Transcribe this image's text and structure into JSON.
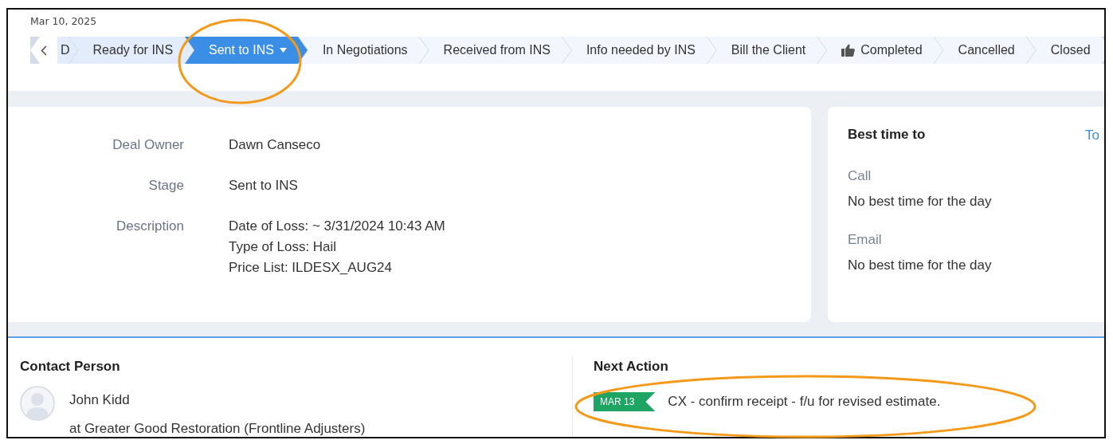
{
  "header": {
    "date": "Mar 10, 2025"
  },
  "stages": [
    {
      "label": "D",
      "kind": "stage",
      "done": true,
      "selected": false
    },
    {
      "label": "Ready for INS",
      "kind": "stage",
      "done": true,
      "selected": false
    },
    {
      "label": "Sent to INS",
      "kind": "stage",
      "done": false,
      "selected": true
    },
    {
      "label": "In Negotiations",
      "kind": "stage",
      "done": false,
      "selected": false
    },
    {
      "label": "Received from INS",
      "kind": "stage",
      "done": false,
      "selected": false
    },
    {
      "label": "Info needed by INS",
      "kind": "stage",
      "done": false,
      "selected": false
    },
    {
      "label": "Bill the Client",
      "kind": "stage",
      "done": false,
      "selected": false
    },
    {
      "label": "Completed",
      "kind": "won",
      "done": false,
      "selected": false
    },
    {
      "label": "Cancelled",
      "kind": "stage",
      "done": false,
      "selected": false
    },
    {
      "label": "Closed",
      "kind": "stage",
      "done": false,
      "selected": false
    }
  ],
  "details": [
    {
      "label": "Deal Owner",
      "lines": [
        "Dawn Canseco"
      ]
    },
    {
      "label": "Stage",
      "lines": [
        "Sent to INS"
      ]
    },
    {
      "label": "Description",
      "lines": [
        "Date of Loss: ~ 3/31/2024 10:43 AM",
        "Type of Loss: Hail",
        "Price List: ILDESX_AUG24"
      ]
    }
  ],
  "best_time": {
    "title": "Best time to",
    "link": "To",
    "fields": [
      {
        "label": "Call",
        "value": "No best time for the day"
      },
      {
        "label": "Email",
        "value": "No best time for the day"
      }
    ]
  },
  "contact": {
    "title": "Contact Person",
    "name": "John Kidd",
    "company": "at Greater Good Restoration (Frontline Adjusters)"
  },
  "next_action": {
    "title": "Next Action",
    "date": "MAR 13",
    "text": "CX - confirm receipt - f/u for revised estimate."
  }
}
